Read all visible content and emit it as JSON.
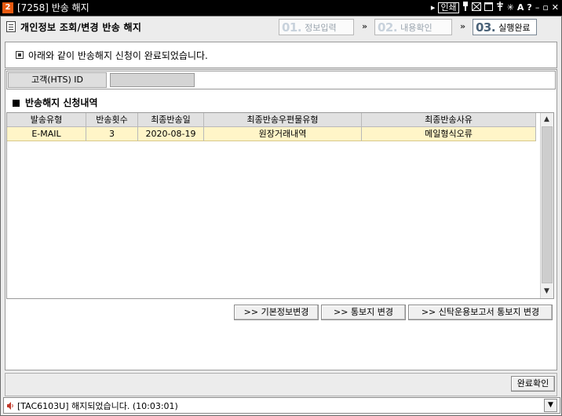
{
  "window": {
    "badge": "2",
    "title": "[7258] 반송 해지",
    "link_label": "인쇄",
    "controls": [
      "pin-icon",
      "mail-icon",
      "window-icon",
      "pin2-icon",
      "asterisk-icon",
      "font-icon",
      "help-icon",
      "minimize-icon",
      "maximize-icon",
      "close-icon"
    ]
  },
  "header": {
    "page_title": "개인정보 조회/변경 반송 해지",
    "steps": [
      {
        "num": "01.",
        "label": "정보입력",
        "active": false
      },
      {
        "num": "02.",
        "label": "내용확인",
        "active": false
      },
      {
        "num": "03.",
        "label": "실행완료",
        "active": true
      }
    ],
    "arrow": "»"
  },
  "message": "아래와 같이 반송해지 신청이 완료되었습니다.",
  "customer": {
    "label": "고객(HTS) ID",
    "value": ""
  },
  "section_title": "반송해지 신청내역",
  "grid": {
    "columns": [
      "발송유형",
      "반송횟수",
      "최종반송일",
      "최종반송우편물유형",
      "최종반송사유"
    ],
    "rows": [
      [
        "E-MAIL",
        "3",
        "2020-08-19",
        "원장거래내역",
        "메일형식오류"
      ]
    ]
  },
  "buttons": {
    "basic_info": ">> 기본정보변경",
    "notice_change": ">> 통보지 변경",
    "trust_notice": ">> 신탁운용보고서 통보지 변경",
    "confirm": "완료확인"
  },
  "status": {
    "text": "[TAC6103U] 해지되었습니다. (10:03:01)"
  },
  "colors": {
    "titlebar": "#000000",
    "badge": "#e85a10",
    "selected_row": "#fff5c8",
    "active_step": "#4a6278"
  }
}
